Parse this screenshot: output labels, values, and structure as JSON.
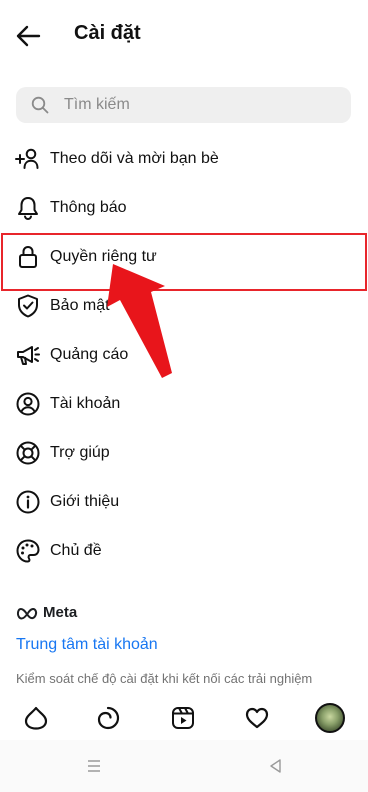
{
  "header": {
    "title": "Cài đặt",
    "back_icon": "arrow-left-icon"
  },
  "search": {
    "placeholder": "Tìm kiếm",
    "icon": "search-icon"
  },
  "menu": {
    "items": [
      {
        "label": "Theo dõi và mời bạn bè",
        "icon": "add-person-icon"
      },
      {
        "label": "Thông báo",
        "icon": "bell-icon"
      },
      {
        "label": "Quyền riêng tư",
        "icon": "lock-icon"
      },
      {
        "label": "Bảo mật",
        "icon": "shield-check-icon"
      },
      {
        "label": "Quảng cáo",
        "icon": "megaphone-icon"
      },
      {
        "label": "Tài khoản",
        "icon": "account-circle-icon"
      },
      {
        "label": "Trợ giúp",
        "icon": "lifebuoy-icon"
      },
      {
        "label": "Giới thiệu",
        "icon": "info-icon"
      },
      {
        "label": "Chủ đề",
        "icon": "palette-icon"
      }
    ]
  },
  "meta": {
    "brand": "Meta",
    "accounts_center": "Trung tâm tài khoản",
    "description": "Kiểm soát chế độ cài đặt khi kết nối các trải nghiệm"
  },
  "tabbar": {
    "icons": [
      "home-icon",
      "search-tab-icon",
      "reels-icon",
      "heart-icon",
      "profile-avatar"
    ]
  },
  "system_nav": {
    "icons": [
      "recents-icon",
      "home-system-icon",
      "back-system-icon"
    ]
  },
  "colors": {
    "accent": "#1877f2",
    "highlight": "#e8252b",
    "arrow": "#e8151b"
  }
}
